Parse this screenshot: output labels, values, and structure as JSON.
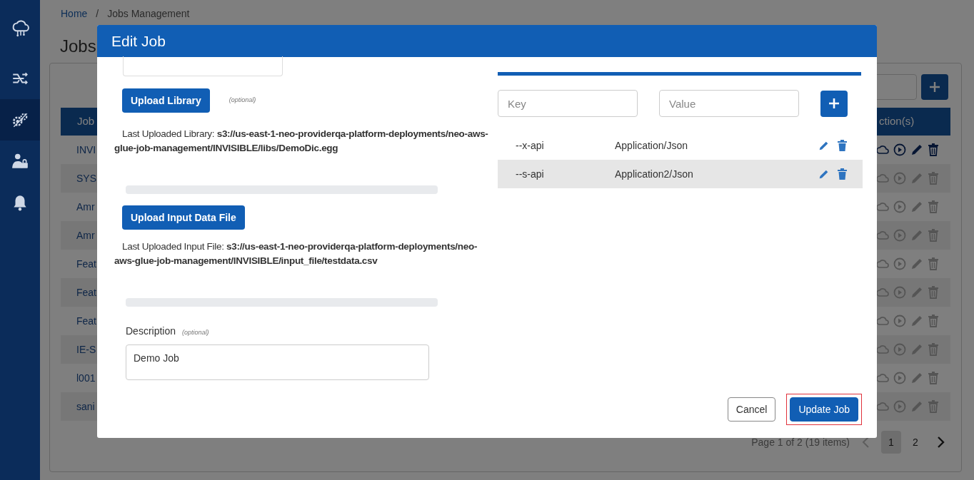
{
  "sidebar": {
    "items": [
      {
        "kind": "cloud",
        "selected": false
      },
      {
        "kind": "flow",
        "selected": false
      },
      {
        "kind": "gears",
        "selected": true
      },
      {
        "kind": "user-lock",
        "selected": false
      },
      {
        "kind": "bell",
        "selected": false
      }
    ]
  },
  "breadcrumb": {
    "items": [
      "Home",
      "Jobs Management"
    ],
    "separator": "/"
  },
  "page_title": "Jobs",
  "table": {
    "columns": [
      "Job",
      "ction(s)"
    ],
    "rows": [
      {
        "name": "INVI",
        "enabled": true
      },
      {
        "name": "SYS",
        "enabled": false
      },
      {
        "name": "Amr",
        "enabled": false
      },
      {
        "name": "Amr",
        "enabled": false
      },
      {
        "name": "Feat",
        "enabled": false
      },
      {
        "name": "Feat",
        "enabled": false
      },
      {
        "name": "Feat",
        "enabled": false
      },
      {
        "name": "IE-S",
        "enabled": false
      },
      {
        "name": "l001",
        "enabled": false
      },
      {
        "name": "sani",
        "enabled": false
      }
    ]
  },
  "pagination": {
    "summary": "Page 1 of 2 (19 items)",
    "pages": [
      {
        "label": "1",
        "selected": true
      },
      {
        "label": "2",
        "selected": false
      }
    ]
  },
  "modal": {
    "title": "Edit Job",
    "left": {
      "upload_library": {
        "button": "Upload Library",
        "hint": "(optional)",
        "last_label": "Last Uploaded Library: ",
        "last_value": "s3://us-east-1-neo-providerqa-platform-deployments/neo-aws-glue-job-management/INVISIBLE/libs/DemoDic.egg",
        "progress": {
          "level": 0
        }
      },
      "upload_input": {
        "button": "Upload Input Data File",
        "last_label": "Last Uploaded Input File: ",
        "last_value": "s3://us-east-1-neo-providerqa-platform-deployments/neo-aws-glue-job-management/INVISIBLE/input_file/testdata.csv",
        "progress": {
          "level": 0
        }
      },
      "description": {
        "label": "Description",
        "hint": "(optional)",
        "value": "Demo Job"
      }
    },
    "right": {
      "key_placeholder": "Key",
      "value_placeholder": "Value",
      "params": [
        {
          "key": "--x-api",
          "value": "Application/Json",
          "selected": false
        },
        {
          "key": "--s-api",
          "value": "Application2/Json",
          "selected": true
        }
      ]
    },
    "buttons": [
      {
        "label": "Cancel",
        "kind": "secondary",
        "focused": false
      },
      {
        "label": "Update Job",
        "kind": "primary",
        "focused": true
      }
    ]
  }
}
